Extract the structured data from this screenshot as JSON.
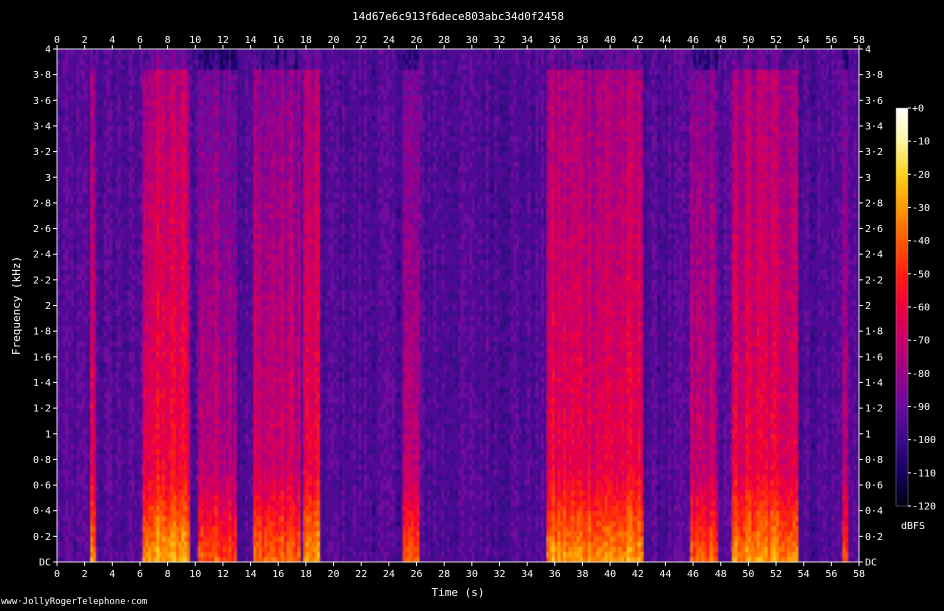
{
  "chart_data": {
    "type": "heatmap",
    "title": "14d67e6c913f6dece803abc34d0f2458",
    "xlabel": "Time (s)",
    "ylabel": "Frequency (kHz)",
    "xlim": [
      0,
      58
    ],
    "ylim": [
      0,
      4
    ],
    "x_ticks": [
      0,
      2,
      4,
      6,
      8,
      10,
      12,
      14,
      16,
      18,
      20,
      22,
      24,
      26,
      28,
      30,
      32,
      34,
      36,
      38,
      40,
      42,
      44,
      46,
      48,
      50,
      52,
      54,
      56,
      58
    ],
    "y_ticks": [
      {
        "value": 0,
        "label": "DC"
      },
      {
        "value": 0.2,
        "label": "0·2"
      },
      {
        "value": 0.4,
        "label": "0·4"
      },
      {
        "value": 0.6,
        "label": "0·6"
      },
      {
        "value": 0.8,
        "label": "0·8"
      },
      {
        "value": 1,
        "label": "1"
      },
      {
        "value": 1.2,
        "label": "1·2"
      },
      {
        "value": 1.4,
        "label": "1·4"
      },
      {
        "value": 1.6,
        "label": "1·6"
      },
      {
        "value": 1.8,
        "label": "1·8"
      },
      {
        "value": 2,
        "label": "2"
      },
      {
        "value": 2.2,
        "label": "2·2"
      },
      {
        "value": 2.4,
        "label": "2·4"
      },
      {
        "value": 2.6,
        "label": "2·6"
      },
      {
        "value": 2.8,
        "label": "2·8"
      },
      {
        "value": 3,
        "label": "3"
      },
      {
        "value": 3.2,
        "label": "3·2"
      },
      {
        "value": 3.4,
        "label": "3·4"
      },
      {
        "value": 3.6,
        "label": "3·6"
      },
      {
        "value": 3.8,
        "label": "3·8"
      },
      {
        "value": 4,
        "label": "4"
      }
    ],
    "colorbar": {
      "label": "dBFS",
      "range": [
        -120,
        0
      ],
      "ticks": [
        {
          "value": 0,
          "label": "+0"
        },
        {
          "value": -10,
          "label": "-10"
        },
        {
          "value": -20,
          "label": "-20"
        },
        {
          "value": -30,
          "label": "-30"
        },
        {
          "value": -40,
          "label": "-40"
        },
        {
          "value": -50,
          "label": "-50"
        },
        {
          "value": -60,
          "label": "-60"
        },
        {
          "value": -70,
          "label": "-70"
        },
        {
          "value": -80,
          "label": "-80"
        },
        {
          "value": -90,
          "label": "-90"
        },
        {
          "value": -100,
          "label": "-100"
        },
        {
          "value": -110,
          "label": "-110"
        },
        {
          "value": -120,
          "label": "-120"
        }
      ],
      "colors": [
        "#ffffff",
        "#fff7a0",
        "#ffd21e",
        "#ff9900",
        "#ff5a00",
        "#ff1e10",
        "#ee0040",
        "#c8006a",
        "#9a008a",
        "#6a0aa0",
        "#3a0a8a",
        "#150060",
        "#000010"
      ]
    },
    "background_level_db": -95,
    "segments": [
      {
        "start": 2.5,
        "end": 2.8,
        "level_db": -60
      },
      {
        "start": 6.2,
        "end": 9.6,
        "level_db": -55
      },
      {
        "start": 10.2,
        "end": 12.9,
        "level_db": -68
      },
      {
        "start": 14.3,
        "end": 17.6,
        "level_db": -65
      },
      {
        "start": 17.8,
        "end": 19.0,
        "level_db": -58
      },
      {
        "start": 25.1,
        "end": 26.1,
        "level_db": -70
      },
      {
        "start": 35.4,
        "end": 42.4,
        "level_db": -58
      },
      {
        "start": 45.8,
        "end": 47.8,
        "level_db": -68
      },
      {
        "start": 48.9,
        "end": 53.6,
        "level_db": -58
      },
      {
        "start": 56.9,
        "end": 57.1,
        "level_db": -65
      }
    ]
  },
  "footer": {
    "text": "www·JollyRogerTelephone·com"
  }
}
